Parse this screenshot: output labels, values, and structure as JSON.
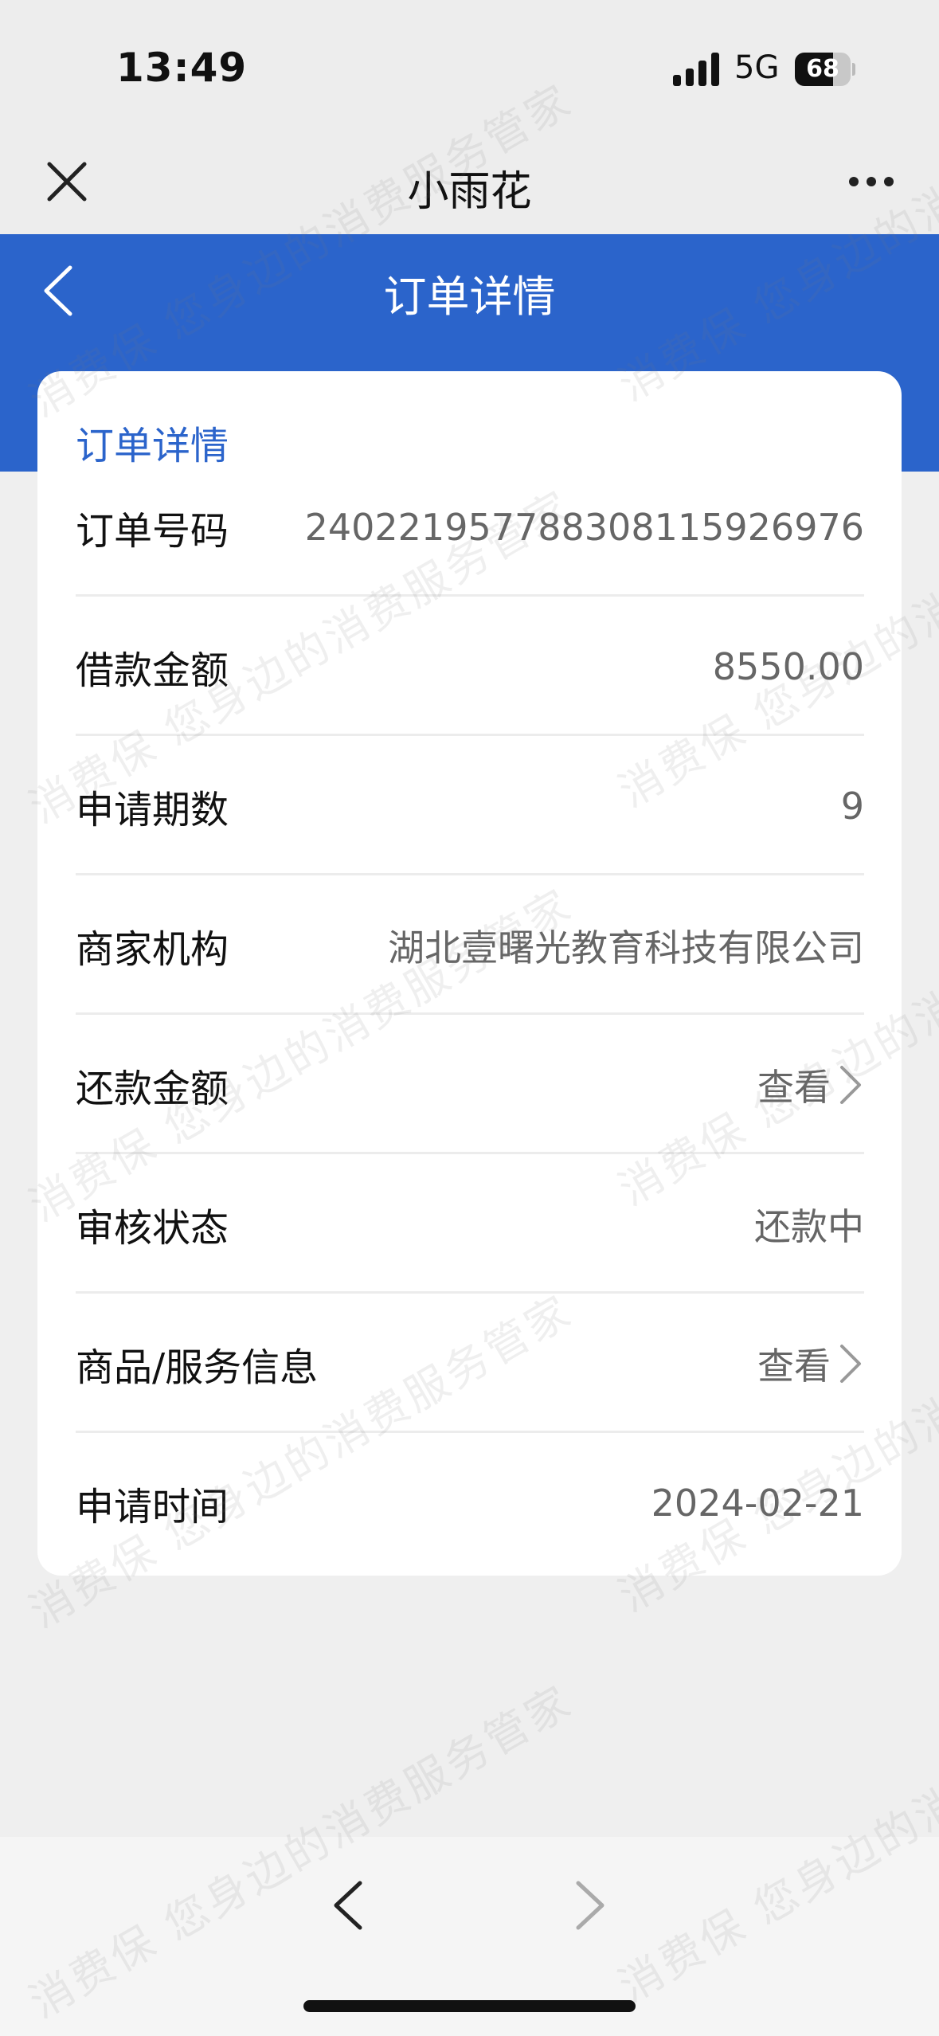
{
  "status_bar": {
    "time": "13:49",
    "network": "5G",
    "battery_level": 68,
    "battery_text": "68"
  },
  "nav_bar": {
    "title": "小雨花",
    "close_icon": "close-icon",
    "more_icon": "more-icon"
  },
  "header": {
    "title": "订单详情",
    "back_icon": "chevron-left-icon",
    "color": "#2b64cb"
  },
  "card": {
    "title": "订单详情",
    "rows": [
      {
        "label": "订单号码",
        "value": "240221957788308115926976"
      },
      {
        "label": "借款金额",
        "value": "8550.00"
      },
      {
        "label": "申请期数",
        "value": "9"
      },
      {
        "label": "商家机构",
        "value": "湖北壹曙光教育科技有限公司"
      },
      {
        "label": "还款金额",
        "value": "查看"
      },
      {
        "label": "审核状态",
        "value": "还款中"
      },
      {
        "label": "商品/服务信息",
        "value": "查看"
      },
      {
        "label": "申请时间",
        "value": "2024-02-21"
      }
    ]
  },
  "watermark": {
    "line_a": "消费保  您身边的消费服务管家",
    "line_b": "消费保  您身边的消费服务管家"
  },
  "bottom_bar": {
    "back_icon": "chevron-left-icon",
    "forward_icon": "chevron-right-icon"
  }
}
